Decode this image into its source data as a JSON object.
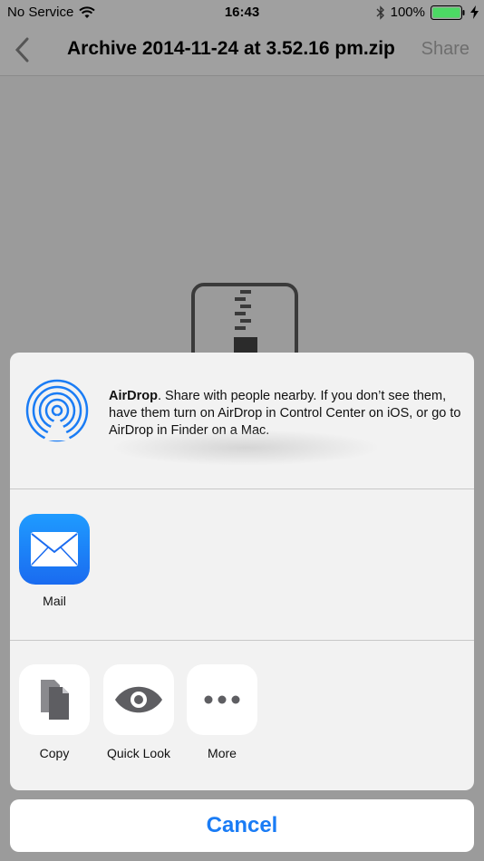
{
  "status_bar": {
    "carrier": "No Service",
    "time": "16:43",
    "battery_percent": "100%"
  },
  "nav_bar": {
    "title": "Archive 2014-11-24 at 3.52.16 pm.zip",
    "share_label": "Share"
  },
  "share_sheet": {
    "airdrop": {
      "title": "AirDrop",
      "description": ". Share with people nearby. If you don’t see them, have them turn on AirDrop in Control Center on iOS, or go to AirDrop in Finder on a Mac."
    },
    "apps": [
      {
        "label": "Mail",
        "icon": "mail-icon"
      }
    ],
    "actions": [
      {
        "label": "Copy",
        "icon": "copy-icon"
      },
      {
        "label": "Quick Look",
        "icon": "eye-icon"
      },
      {
        "label": "More",
        "icon": "more-icon"
      }
    ],
    "cancel_label": "Cancel"
  },
  "colors": {
    "accent": "#1a7cf5",
    "mail_tile": "#1f9bff",
    "sheet_background": "#f2f2f2",
    "dim_background": "#9b9b9b"
  }
}
